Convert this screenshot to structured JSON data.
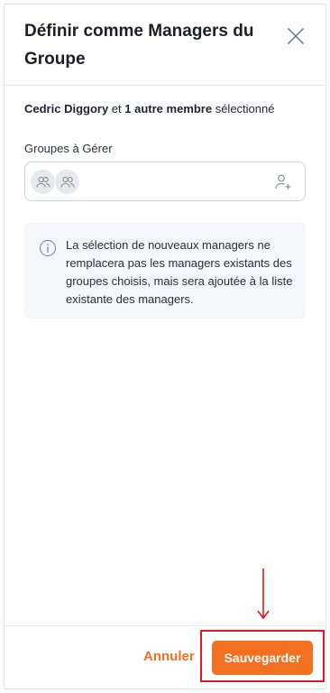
{
  "dialog": {
    "title": "Définir comme Managers du Groupe",
    "close_icon": "close-icon"
  },
  "selection": {
    "member_name": "Cedric Diggory",
    "connector": " et ",
    "others_count": "1 autre membre",
    "suffix": " sélectionné"
  },
  "groups_field": {
    "label": "Groupes à Gérer",
    "avatar_icons": [
      "group-icon",
      "group-icon"
    ],
    "add_icon": "add-user-icon"
  },
  "info": {
    "icon": "info-icon",
    "text": "La sélection de nouveaux managers ne remplacera pas les managers existants des groupes choisis, mais sera ajoutée à la liste existante des managers."
  },
  "footer": {
    "cancel_label": "Annuler",
    "save_label": "Sauvegarder"
  },
  "colors": {
    "accent": "#f37021",
    "annotation": "#e3191f",
    "info_bg": "#f4f6f9"
  }
}
